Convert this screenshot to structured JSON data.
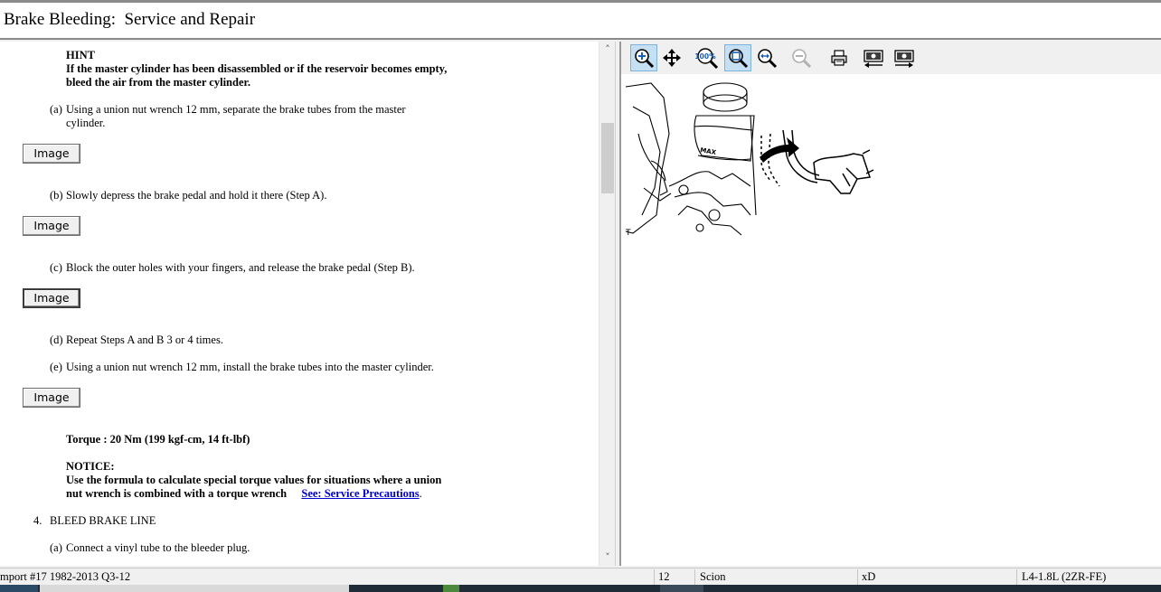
{
  "window": {
    "title": "Brake Bleeding:  Service and Repair"
  },
  "document": {
    "hint_title": "HINT",
    "hint_line1": "If the master cylinder has been disassembled or if the reservoir becomes empty,",
    "hint_line2": "bleed the air from the master cylinder.",
    "step_a_label": "(a)",
    "step_a_line1": "Using a union nut wrench 12 mm, separate the brake tubes from the master",
    "step_a_line2": "cylinder.",
    "image_button_label": "Image",
    "step_b_label": "(b)",
    "step_b_text": "Slowly depress the brake pedal and hold it there (Step A).",
    "step_c_label": "(c)",
    "step_c_text": "Block the outer holes with your fingers, and release the brake pedal (Step B).",
    "step_d_label": "(d)",
    "step_d_text": "Repeat Steps A and B 3 or 4 times.",
    "step_e_label": "(e)",
    "step_e_text": "Using a union nut wrench 12 mm, install the brake tubes into the master cylinder.",
    "torque_text": "Torque : 20 Nm (199 kgf-cm, 14 ft-lbf)",
    "notice_title": "NOTICE:",
    "notice_line1": "Use the formula to calculate special torque values for situations where a union",
    "notice_line2": "nut wrench is combined with a torque wrench",
    "notice_link": "See: Service Precautions",
    "notice_period": ".",
    "section_number": "4.",
    "section_title": "BLEED BRAKE LINE",
    "step_4a_label": "(a)",
    "step_4a_text": "Connect a vinyl tube to the bleeder plug."
  },
  "scrollbar": {
    "up_glyph": "˄",
    "down_glyph": "˅"
  },
  "toolbar": {
    "zoom_100_label": "100%",
    "icons": [
      "zoom-in-icon",
      "pan-icon",
      "zoom-100-icon",
      "zoom-fit-icon",
      "zoom-width-icon",
      "zoom-out-icon",
      "print-icon",
      "previous-image-icon",
      "next-image-icon"
    ]
  },
  "diagram": {
    "max_label": "MAX",
    "corner_label": "T"
  },
  "statusbar": {
    "source": "mport #17 1982-2013 Q3-12",
    "number": "12",
    "make": "Scion",
    "model": "xD",
    "engine": "L4-1.8L (2ZR-FE)"
  },
  "colors": {
    "link": "#0000cc",
    "active_tool": "#c5dff3",
    "accent": "#1a5fb4"
  }
}
